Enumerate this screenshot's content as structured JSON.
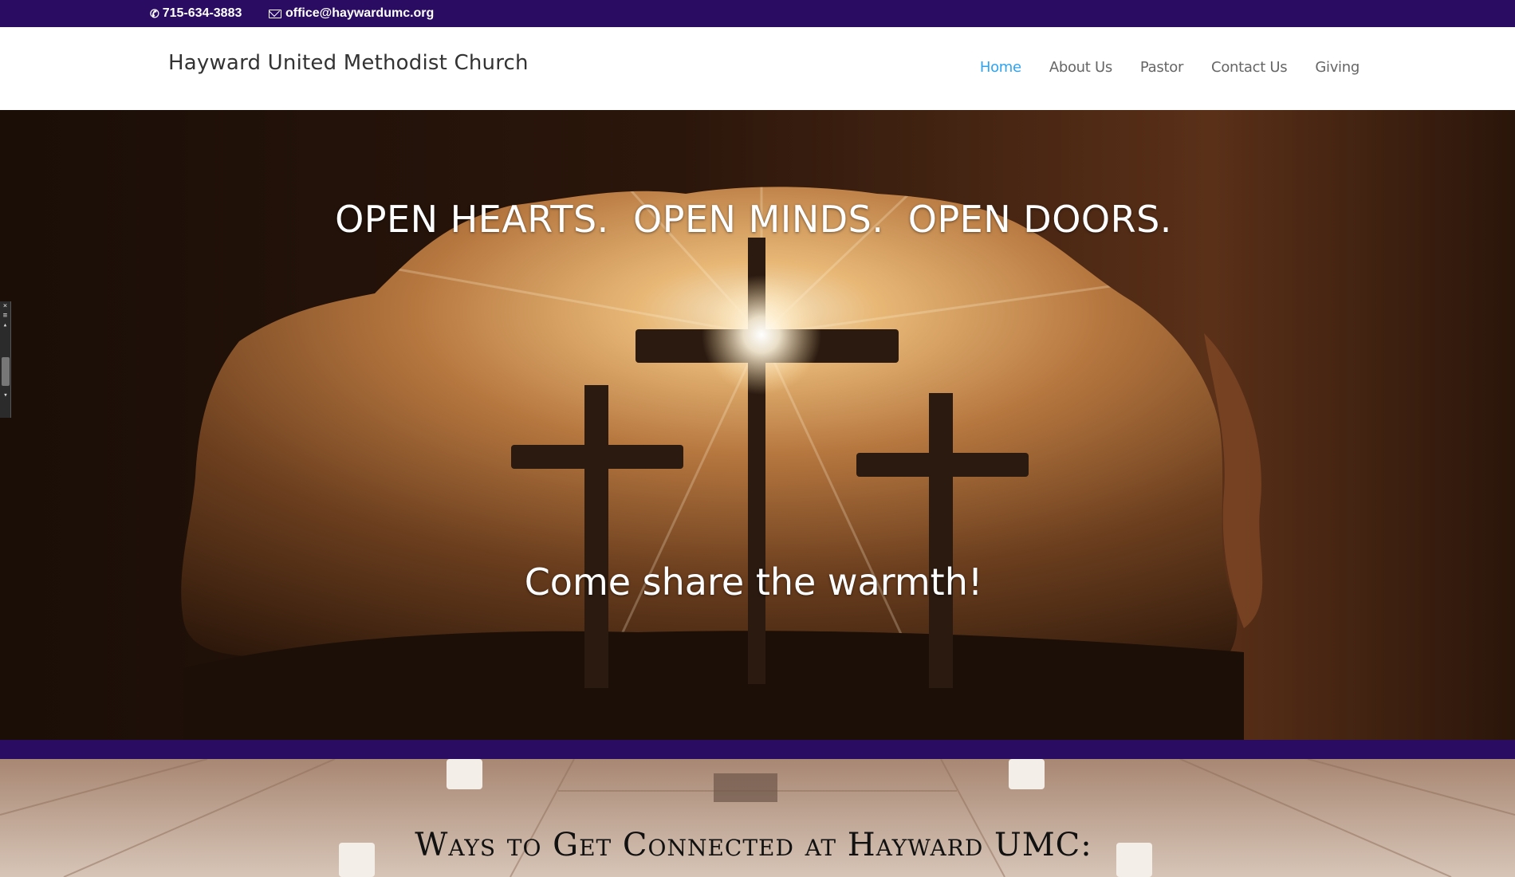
{
  "topbar": {
    "phone": "715-634-3883",
    "email": "office@haywardumc.org"
  },
  "header": {
    "site_title": "Hayward United Methodist Church",
    "nav": [
      {
        "label": "Home",
        "active": true
      },
      {
        "label": "About Us",
        "active": false
      },
      {
        "label": "Pastor",
        "active": false
      },
      {
        "label": "Contact Us",
        "active": false
      },
      {
        "label": "Giving",
        "active": false
      }
    ]
  },
  "hero": {
    "headline": "OPEN HEARTS.  OPEN MINDS.  OPEN DOORS.",
    "subline": "Come share the warmth!"
  },
  "section": {
    "title": "Ways to Get Connected at Hayward UMC:"
  },
  "side_widget": {
    "close": "×",
    "up": "▴",
    "down": "▾"
  },
  "colors": {
    "brand_purple": "#2a0d63",
    "nav_active": "#2ea3f2",
    "nav_text": "#666666"
  },
  "icons": {
    "phone": "phone-icon",
    "email": "envelope-icon"
  }
}
